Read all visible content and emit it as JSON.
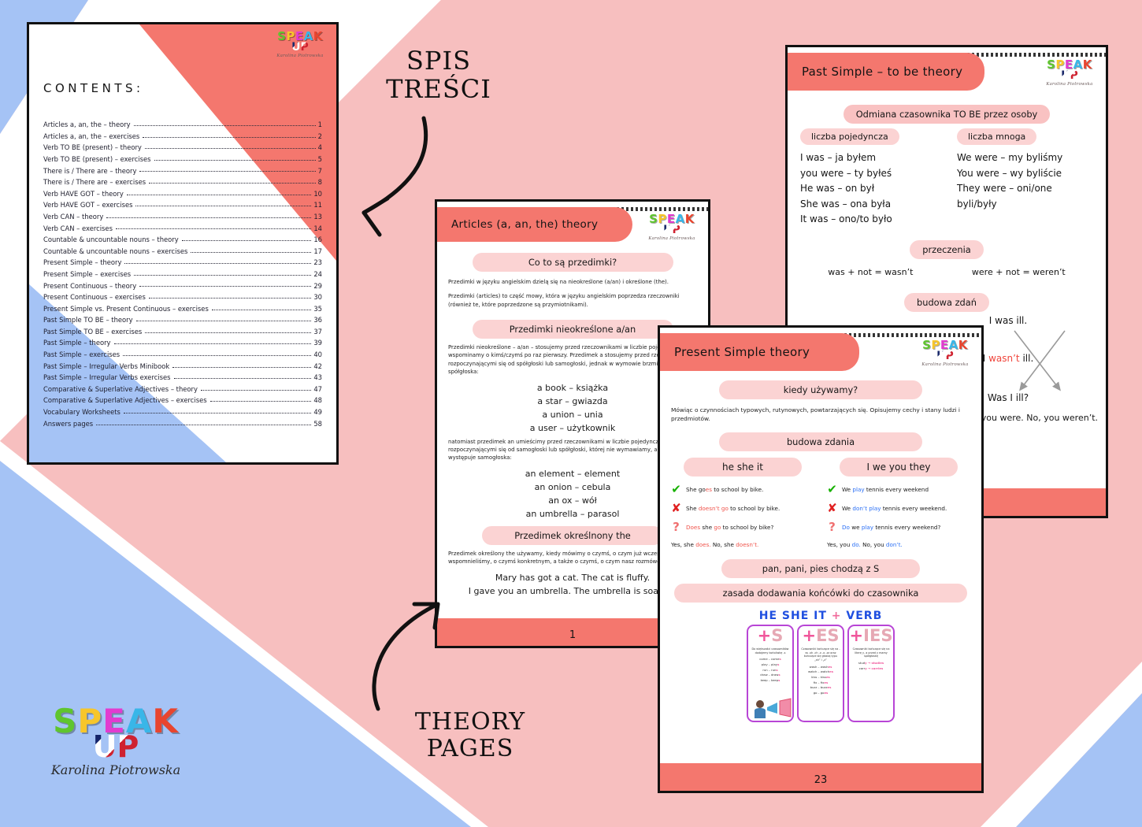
{
  "background": {
    "band_pink_dark": "#f4776e",
    "band_pink": "#f7bfbf",
    "band_white": "#ffffff",
    "band_blue": "#a5c3f5"
  },
  "annotations": {
    "spis_tresci_line1": "SPIS",
    "spis_tresci_line2": "TREŚCI",
    "theory_line1": "THEORY",
    "theory_line2": "PAGES"
  },
  "brand": {
    "speak": "SPEAK",
    "up": "UP",
    "author": "Karolina Piotrowska"
  },
  "logo": {
    "speak": "SPEAK",
    "up": "UP",
    "author": "Karolina Piotrowska"
  },
  "contents_page": {
    "title": "CONTENTS:",
    "items": [
      {
        "label": "Articles a, an, the – theory",
        "page": "1"
      },
      {
        "label": "Articles a, an, the – exercises",
        "page": "2"
      },
      {
        "label": "Verb TO BE (present) – theory",
        "page": "4"
      },
      {
        "label": "Verb TO BE (present) – exercises",
        "page": "5"
      },
      {
        "label": "There is / There are – theory",
        "page": "7"
      },
      {
        "label": "There is / There are – exercises",
        "page": "8"
      },
      {
        "label": "Verb HAVE GOT – theory",
        "page": "10"
      },
      {
        "label": "Verb HAVE GOT – exercises",
        "page": "11"
      },
      {
        "label": "Verb CAN – theory",
        "page": "13"
      },
      {
        "label": "Verb CAN – exercises",
        "page": "14"
      },
      {
        "label": "Countable & uncountable nouns – theory",
        "page": "16"
      },
      {
        "label": "Countable & uncountable nouns – exercises",
        "page": "17"
      },
      {
        "label": "Present Simple – theory",
        "page": "23"
      },
      {
        "label": "Present Simple – exercises",
        "page": "24"
      },
      {
        "label": "Present Continuous – theory",
        "page": "29"
      },
      {
        "label": "Present Continuous – exercises",
        "page": "30"
      },
      {
        "label": "Present Simple vs. Present Continuous – exercises",
        "page": "35"
      },
      {
        "label": "Past Simple TO BE – theory",
        "page": "36"
      },
      {
        "label": "Past Simple TO BE – exercises",
        "page": "37"
      },
      {
        "label": "Past Simple – theory",
        "page": "39"
      },
      {
        "label": "Past Simple – exercises",
        "page": "40"
      },
      {
        "label": "Past Simple – Irregular Verbs Minibook",
        "page": "42"
      },
      {
        "label": "Past Simple – Irregular Verbs exercises",
        "page": "43"
      },
      {
        "label": "Comparative & Superlative Adjectives – theory",
        "page": "47"
      },
      {
        "label": "Comparative & Superlative Adjectives – exercises",
        "page": "48"
      },
      {
        "label": "Vocabulary Worksheets",
        "page": "49"
      },
      {
        "label": "Answers pages",
        "page": "58"
      }
    ]
  },
  "articles_page": {
    "title": "Articles (a, an, the) theory",
    "section1_pill": "Co to są przedimki?",
    "section1_p1": "Przedimki w języku angielskim dzielą się na nieokreślone (a/an) i określone (the).",
    "section1_p2": "Przedimki (articles) to część mowy, która w języku angielskim poprzedza rzeczowniki (również te, które poprzedzone są przymiotnikami).",
    "section2_pill": "Przedimki nieokreślone a/an",
    "section2_p": "Przedimki nieokreślone – a/an – stosujemy przed rzeczownikami w liczbie pojedynczej, gdy wspominamy o kimś/czymś po raz pierwszy. Przedimek a stosujemy przed rzeczownikami rozpoczynającymi się od spółgłoski lub samogłoski, jednak w wymowie brzmiącymi jak spółgłoska:",
    "examples_a": [
      "a book – książka",
      "a star – gwiazda",
      "a union – unia",
      "a user – użytkownik"
    ],
    "section2_p2": "natomiast przedimek an umieścimy przed rzeczownikami w liczbie pojedynczej rozpoczynającymi się od samogłoski lub spółgłoski, której nie wymawiamy, a po której występuje samogłoska:",
    "examples_an": [
      "an element – element",
      "an onion – cebula",
      "an ox – wół",
      "an umbrella – parasol"
    ],
    "section3_pill": "Przedimek określnony the",
    "section3_p": "Przedimek określony the używamy, kiedy mówimy o czymś, o czym już wcześniej wspomnieliśmy, o czymś konkretnym, a także o czymś, o czym nasz rozmówca wie.",
    "examples_the": [
      "Mary has got a cat. The cat is fluffy.",
      "I gave you an umbrella. The umbrella is soaked."
    ],
    "footer_page": "1"
  },
  "past_simple_page": {
    "title": "Past Simple – to be  theory",
    "section1_pill": "Odmiana czasownika TO BE przez osoby",
    "singular_pill": "liczba pojedyncza",
    "plural_pill": "liczba mnoga",
    "singular": [
      "I was – ja byłem",
      "you were – ty byłeś",
      "He was – on był",
      "She was – ona była",
      "It was – ono/to było"
    ],
    "plural": [
      "We were – my byliśmy",
      "You were – wy byliście",
      "They were – oni/one byli/były"
    ],
    "negation_pill": "przeczenia",
    "negation_left": "was + not = wasn’t",
    "negation_right": "were + not = weren’t",
    "build_pill": "budowa zdań",
    "sentence_affirmative": "I  was ill.",
    "sentence_negative_pre": "I ",
    "sentence_negative_red": "wasn’t",
    "sentence_negative_post": " ill.",
    "sentence_question": "Was   I    ill?",
    "short_answers": "Yes, you were.  No, you weren’t."
  },
  "present_simple_page": {
    "title": "Present Simple   theory",
    "when_pill": "kiedy używamy?",
    "when_text": "Mówiąc o czynnościach typowych, rutynowych, powtarzających się. Opisujemy cechy i stany ludzi i przedmiotów.",
    "build_pill": "budowa zdania",
    "col_left_pill": "he she it",
    "col_right_pill": "I we you they",
    "left_rows": [
      {
        "mark": "check-icon",
        "pre": "She go",
        "mid": "es",
        "post": " to school by bike.",
        "mid_color": "red"
      },
      {
        "mark": "cross-icon",
        "pre": "She ",
        "mid": "doesn’t go",
        "post": " to school by bike.",
        "mid_color": "red"
      },
      {
        "mark": "question-icon",
        "pre": "",
        "mid": "Does",
        "post": " she ",
        "extra": "go",
        "tail": " to school by bike?",
        "mid_color": "red"
      }
    ],
    "left_answer_pre": "Yes, she ",
    "left_answer_a": "does.",
    "left_answer_mid": "  No, she ",
    "left_answer_b": "doesn’t.",
    "right_rows": [
      {
        "mark": "check-icon",
        "pre": "We ",
        "mid": "play",
        "post": " tennis every weekend",
        "mid_color": "blue"
      },
      {
        "mark": "cross-icon",
        "pre": "We ",
        "mid": "don’t play",
        "post": " tennis every weekend.",
        "mid_color": "blue"
      },
      {
        "mark": "question-icon",
        "pre": "",
        "mid": "Do",
        "post": " we ",
        "extra": "play",
        "tail": " tennis every weekend?",
        "mid_color": "blue"
      }
    ],
    "right_answer_pre": "Yes, you ",
    "right_answer_a": "do.",
    "right_answer_mid": "  No, you ",
    "right_answer_b": "don’t.",
    "rule_pill_1": "pan, pani, pies chodzą z S",
    "rule_pill_2": "zasada dodawania końcówki do czasownika",
    "hsv_text": "HE SHE IT",
    "hsv_plus": "+",
    "hsv_verb": "VERB",
    "boxes": [
      {
        "plus": "+",
        "suffix": "S",
        "desc": "Do większości czasowników dodajemy końcówkę -s",
        "list": [
          {
            "base": "come – come",
            "end": "s"
          },
          {
            "base": "play – play",
            "end": "s"
          },
          {
            "base": "run – run",
            "end": "s"
          },
          {
            "base": "draw – draw",
            "end": "s"
          },
          {
            "base": "keep – keep",
            "end": "s"
          }
        ]
      },
      {
        "plus": "+",
        "suffix": "ES",
        "desc": "Czasowniki kończące się na -ss -sh -ch -x -o -zz oraz kończące się głoską typu „sh” i „z”",
        "list": [
          {
            "base": "wash – wash",
            "end": "es"
          },
          {
            "base": "watch – watch",
            "end": "es"
          },
          {
            "base": "kiss – kiss",
            "end": "es"
          },
          {
            "base": "fix – fix",
            "end": "es"
          },
          {
            "base": "buzz – buzz",
            "end": "es"
          },
          {
            "base": "go – go",
            "end": "es"
          }
        ]
      },
      {
        "plus": "+",
        "suffix": "IES",
        "desc": "Czasowniki kończące się na literę y, a przed y mamy spółgłoskę",
        "list": [
          {
            "base": "stud",
            "end": "y → studies"
          },
          {
            "base": "carr",
            "end": "y → carries"
          }
        ]
      }
    ],
    "footer_page": "23"
  }
}
